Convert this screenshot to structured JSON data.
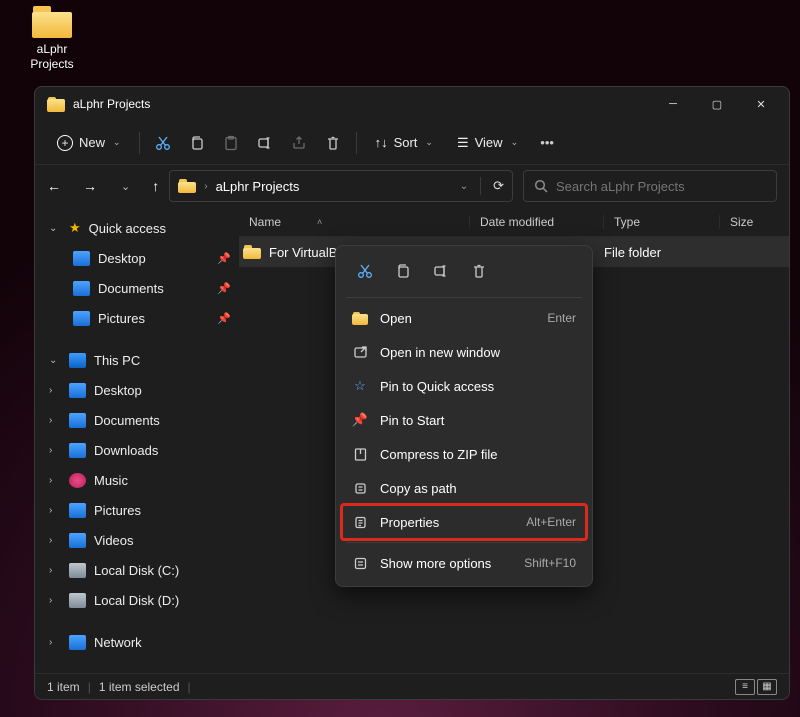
{
  "desktop": {
    "folder_label": "aLphr Projects"
  },
  "window": {
    "title": "aLphr Projects",
    "toolbar": {
      "new": "New",
      "sort": "Sort",
      "view": "View"
    },
    "address": {
      "path": "aLphr Projects"
    },
    "search": {
      "placeholder": "Search aLphr Projects"
    },
    "sidebar": {
      "quick_access": "Quick access",
      "desktop": "Desktop",
      "documents": "Documents",
      "pictures": "Pictures",
      "this_pc": "This PC",
      "pc_desktop": "Desktop",
      "pc_documents": "Documents",
      "pc_downloads": "Downloads",
      "pc_music": "Music",
      "pc_pictures": "Pictures",
      "pc_videos": "Videos",
      "local_c": "Local Disk (C:)",
      "local_d": "Local Disk (D:)",
      "network": "Network"
    },
    "columns": {
      "name": "Name",
      "date": "Date modified",
      "type": "Type",
      "size": "Size"
    },
    "rows": [
      {
        "name": "For VirtualB",
        "type": "File folder"
      }
    ],
    "context_menu": {
      "open": "Open",
      "open_sc": "Enter",
      "open_new": "Open in new window",
      "pin_qa": "Pin to Quick access",
      "pin_start": "Pin to Start",
      "zip": "Compress to ZIP file",
      "copy_path": "Copy as path",
      "properties": "Properties",
      "properties_sc": "Alt+Enter",
      "more": "Show more options",
      "more_sc": "Shift+F10"
    },
    "status": {
      "count": "1 item",
      "selected": "1 item selected"
    }
  }
}
